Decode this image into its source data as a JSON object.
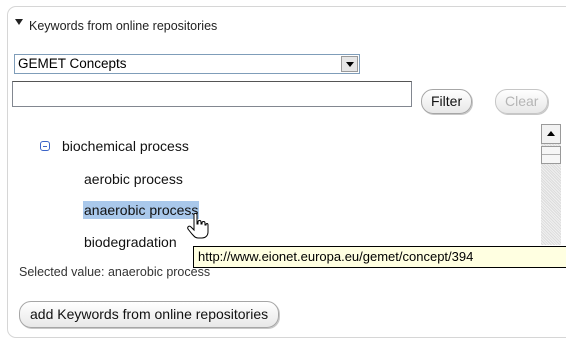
{
  "section": {
    "title": "Keywords from online repositories"
  },
  "thesaurus_select": {
    "value": "GEMET Concepts"
  },
  "filter_input": {
    "value": ""
  },
  "buttons": {
    "filter": "Filter",
    "clear": "Clear",
    "add": "add Keywords from online repositories"
  },
  "tree": {
    "parent": "biochemical process",
    "children": [
      "aerobic process",
      "anaerobic process",
      "biodegradation"
    ],
    "selected_index": 1
  },
  "selected_value": "Selected value: anaerobic process",
  "tooltip": "http://www.eionet.europa.eu/gemet/concept/394",
  "colors": {
    "selection": "#a9c8eb",
    "tooltip_bg": "#ffffe1",
    "tree_icon": "#3b64c7"
  },
  "icons": {
    "expand": "collapse-minus-icon",
    "cursor": "hand-pointer-icon"
  }
}
